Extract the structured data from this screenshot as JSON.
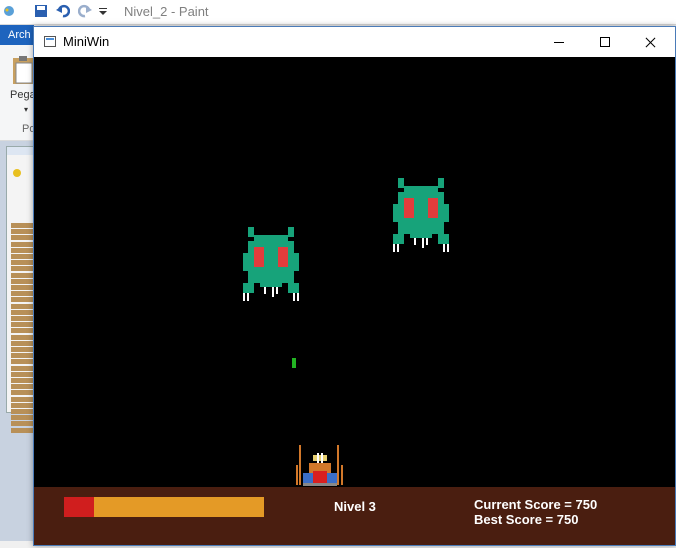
{
  "paint": {
    "title": "Nivel_2 - Paint",
    "ribbon_tab": "Arch",
    "paste_label": "Pega",
    "group_label": "Po"
  },
  "miniwin": {
    "title": "MiniWin"
  },
  "game": {
    "level_text": "Nivel  3",
    "current_score_text": "Current Score = 750",
    "best_score_text": "Best Score = 750",
    "health_fraction": 0.15,
    "colors": {
      "alien_body": "#17a37a",
      "alien_eyes": "#e23c3c",
      "fangs": "#ffffff",
      "hud_bg": "#4a1e10",
      "health_bar": "#e49a26",
      "health_fill": "#d01e1e",
      "bullet": "#22b422"
    }
  }
}
